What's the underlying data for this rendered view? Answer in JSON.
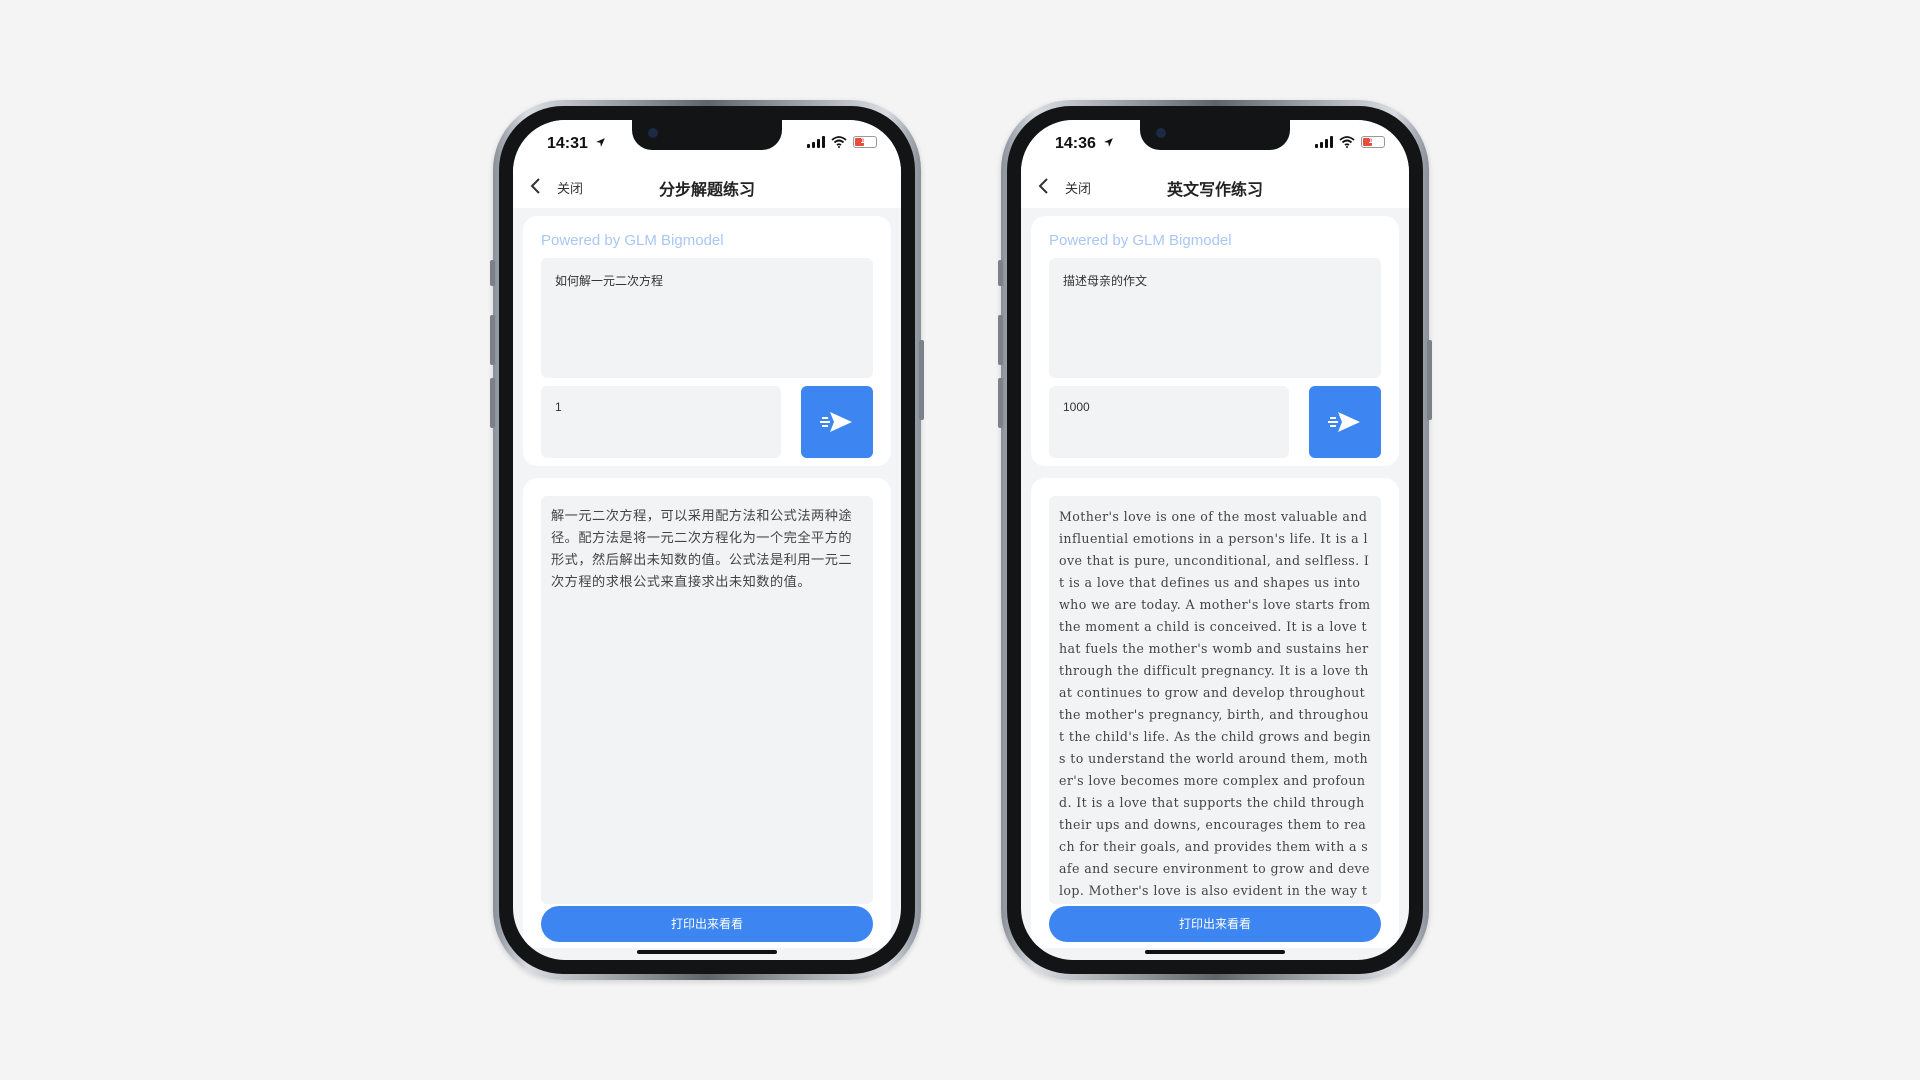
{
  "phones": [
    {
      "time": "14:31",
      "battery": "16",
      "close_label": "关闭",
      "title": "分步解题练习",
      "powered_by": "Powered by GLM Bigmodel",
      "prompt": "如何解一元二次方程",
      "number": "1",
      "output": "解一元二次方程，可以采用配方法和公式法两种途径。配方法是将一元二次方程化为一个完全平方的形式，然后解出未知数的值。公式法是利用一元二次方程的求根公式来直接求出未知数的值。",
      "print_label": "打印出来看看"
    },
    {
      "time": "14:36",
      "battery": "16",
      "close_label": "关闭",
      "title": "英文写作练习",
      "powered_by": "Powered by GLM Bigmodel",
      "prompt": "描述母亲的作文",
      "number": "1000",
      "output": "Mother's love is one of the most valuable and influential emotions in a person's life. It is a love that is pure, unconditional, and selfless. It is a love that defines us and shapes us into who we are today. A mother's love starts from the moment a child is conceived. It is a love that fuels the mother's womb and sustains her through the difficult pregnancy. It is a love that continues to grow and develop throughout the mother's pregnancy, birth, and throughout the child's life. As the child grows and begins to understand the world around them, mother's love becomes more complex and profound. It is a love that supports the child through their ups and downs, encourages them to reach for their goals, and provides them with a safe and secure environment to grow and develop. Mother's love is also evident in the way they take care of their children's nee",
      "print_label": "打印出来看看"
    }
  ],
  "colors": {
    "accent": "#3d86f1",
    "powered_text": "#a9c7f5",
    "battery_low": "#e74c3c",
    "box_bg": "#f2f3f5"
  },
  "icons": [
    "location-arrow-icon",
    "signal-icon",
    "wifi-icon",
    "battery-icon",
    "chevron-left-icon",
    "send-icon"
  ]
}
